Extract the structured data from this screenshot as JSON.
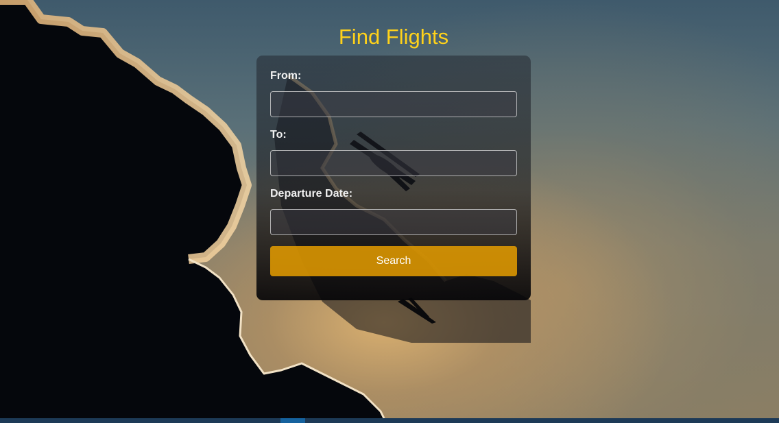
{
  "page": {
    "title": "Find Flights"
  },
  "form": {
    "from_label": "From:",
    "from_value": "",
    "to_label": "To:",
    "to_value": "",
    "date_label": "Departure Date:",
    "date_value": "",
    "search_label": "Search"
  },
  "colors": {
    "title": "#ffd21a",
    "button": "#e69e00",
    "bottom_bar": "#1d3a57",
    "bottom_bar_thumb": "#15629e"
  },
  "background": {
    "description_icon": "biplane-silhouette-icon"
  }
}
